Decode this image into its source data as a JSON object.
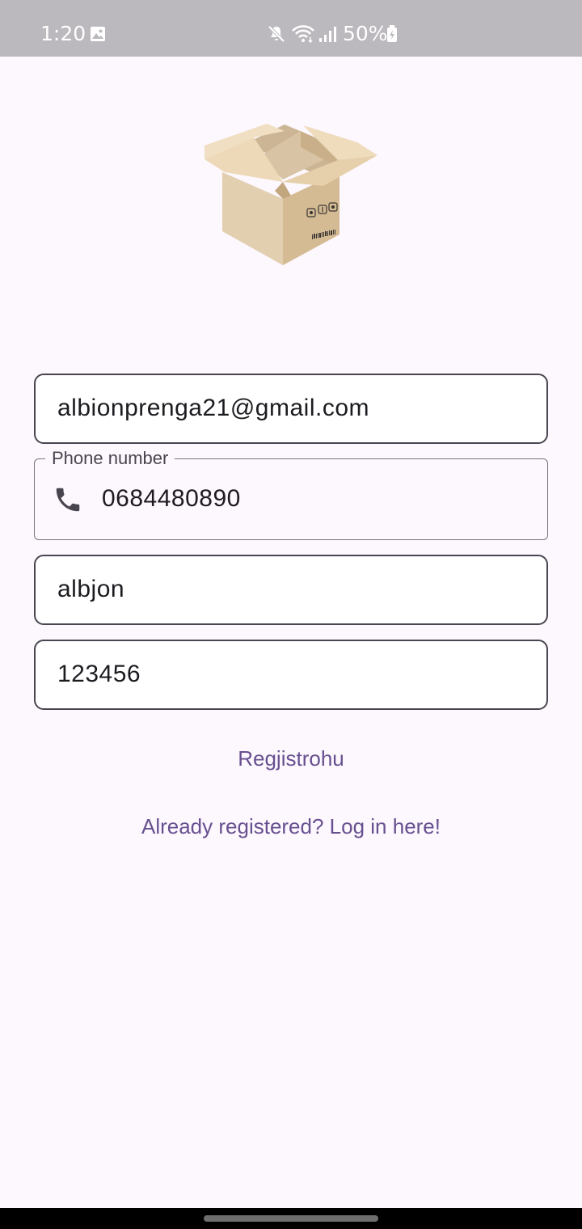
{
  "status_bar": {
    "time": "1:20",
    "battery": "50%",
    "icons": [
      "gallery-icon",
      "mute-icon",
      "wifi-icon",
      "signal-icon",
      "battery-icon"
    ]
  },
  "logo": {
    "icon": "cardboard-box-icon"
  },
  "form": {
    "email": {
      "value": "albionprenga21@gmail.com"
    },
    "phone": {
      "label": "Phone number",
      "value": "0684480890",
      "icon": "phone-icon"
    },
    "name": {
      "value": "albjon"
    },
    "password": {
      "value": "123456"
    }
  },
  "actions": {
    "register_label": "Regjistrohu",
    "login_link": "Already registered? Log in here!"
  },
  "colors": {
    "background": "#fdf7fe",
    "accent": "#67508f",
    "field_border": "#4a4550",
    "status_bar": "#bcb9be"
  }
}
